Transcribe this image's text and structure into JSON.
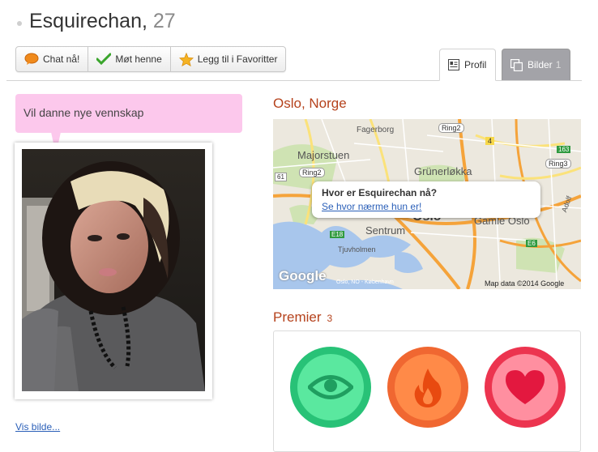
{
  "profile": {
    "name": "Esquirechan,",
    "age": "27"
  },
  "actions": [
    {
      "label": "Chat nå!",
      "icon": "speech-bubble-icon"
    },
    {
      "label": "Møt henne",
      "icon": "checkmark-icon"
    },
    {
      "label": "Legg til i Favoritter",
      "icon": "star-icon"
    }
  ],
  "tabs": {
    "profil": {
      "label": "Profil",
      "icon": "profile-card-icon"
    },
    "bilder": {
      "label": "Bilder",
      "count": "1",
      "icon": "photos-icon"
    }
  },
  "status_bubble": "Vil danne nye vennskap",
  "photo_link": "Vis bilde...",
  "location": "Oslo, Norge",
  "map": {
    "popup_title": "Hvor er Esquirechan nå?",
    "popup_link": "Se hvor nærme hun er!",
    "credit": "Map data ©2014 Google",
    "logo": "Google",
    "street_text": "Oslo, NO - København",
    "labels": [
      "Fagerborg",
      "Ring2",
      "Majorstuen",
      "Grünerløkka",
      "Ring3",
      "Sentrum",
      "Oslo",
      "Gamle Oslo",
      "Tjuvholmen",
      "E18",
      "E6",
      "Ring2",
      "163",
      "4",
      "61",
      "Adolf"
    ]
  },
  "premier": {
    "title": "Premier",
    "count": "3",
    "items": [
      {
        "icon": "eye-icon",
        "color": "#28c277"
      },
      {
        "icon": "flame-icon",
        "color": "#f06731"
      },
      {
        "icon": "heart-icon",
        "color": "#ec344f"
      }
    ]
  },
  "colors": {
    "accent": "#b5421c",
    "link": "#2a5fb8",
    "bubble": "#fcc8ec"
  }
}
